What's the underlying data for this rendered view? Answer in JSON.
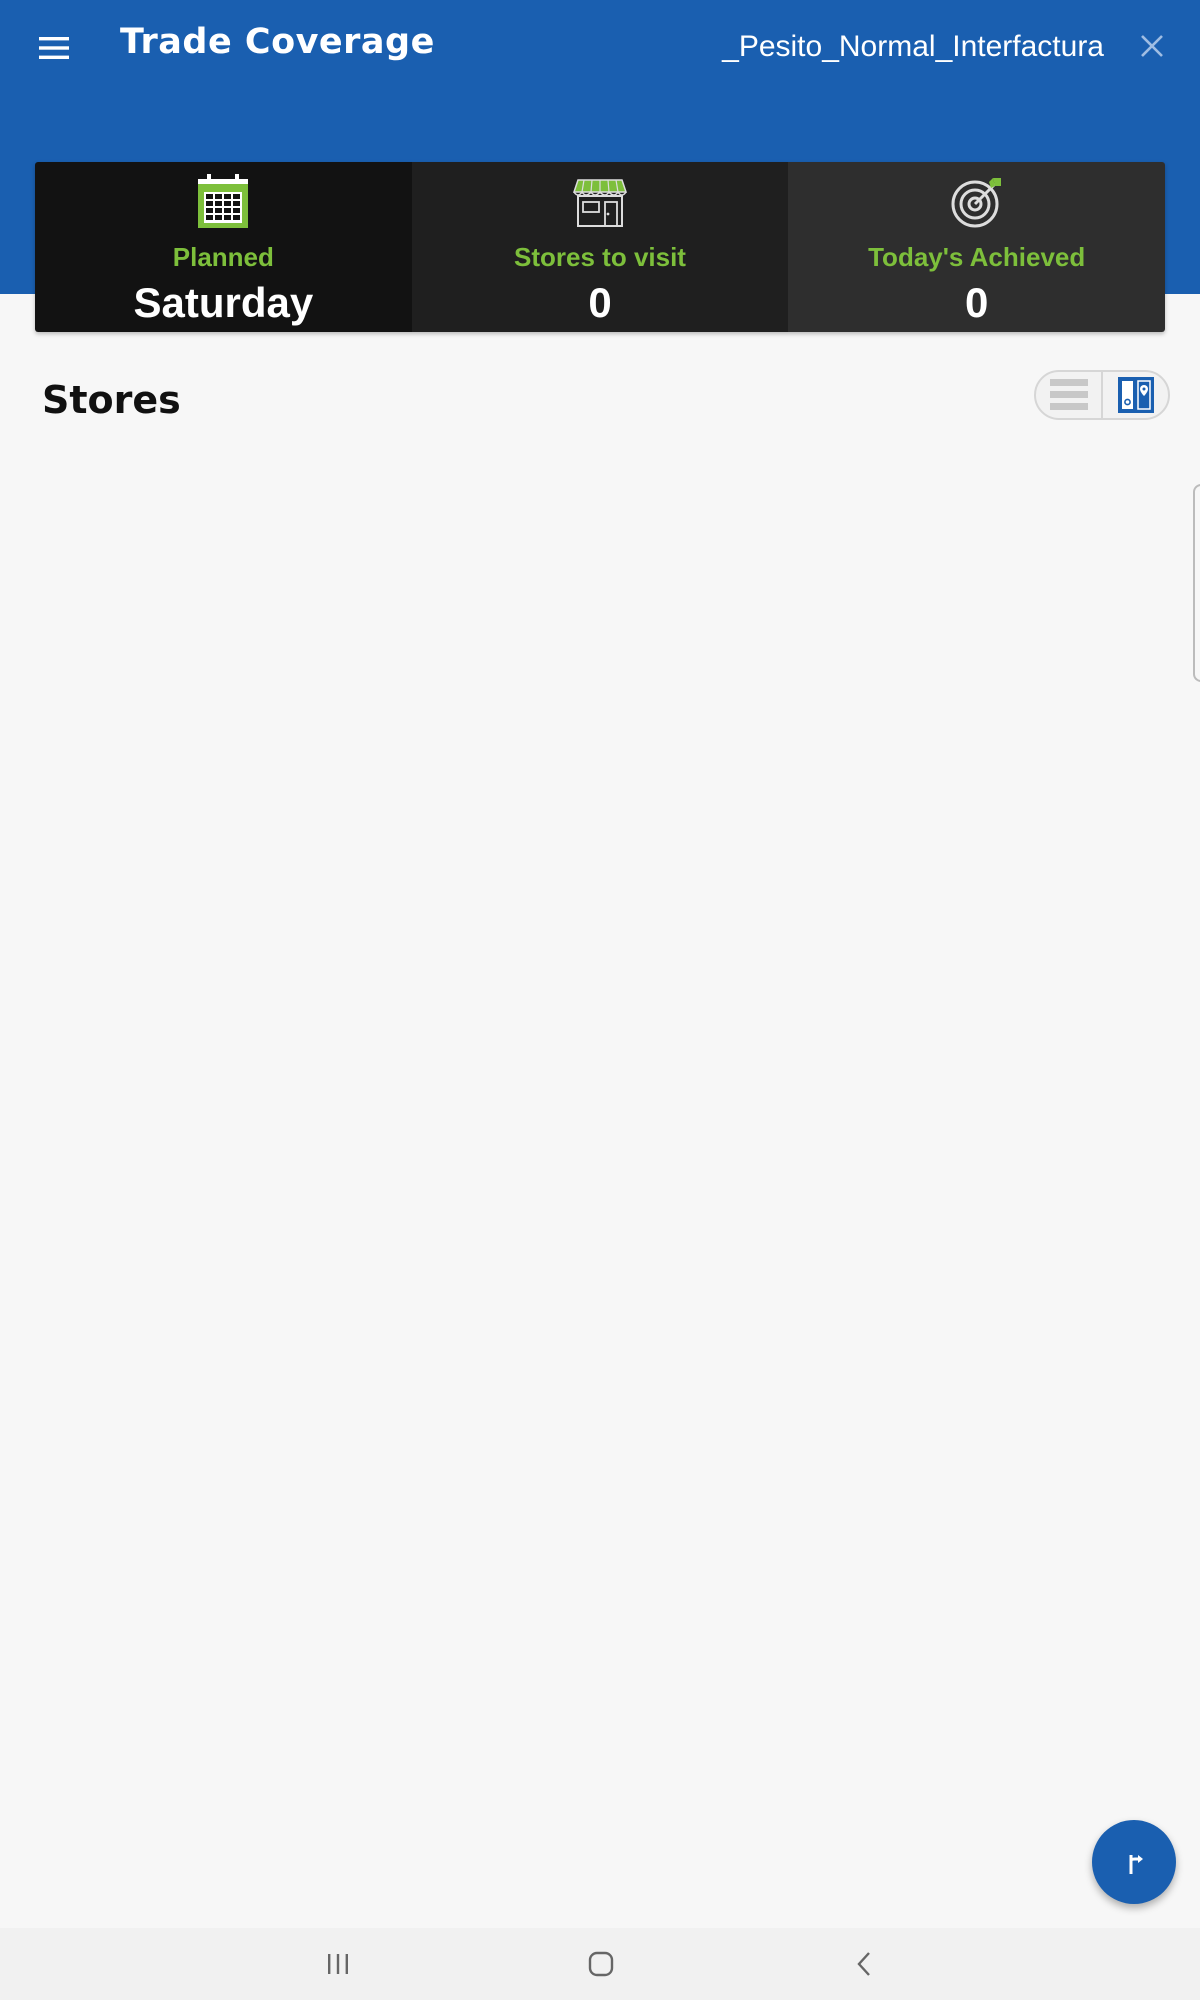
{
  "header": {
    "title": "Trade Coverage",
    "profile_name": "_Pesito_Normal_Interfactura",
    "icons": {
      "menu": "hamburger-menu-icon",
      "close": "close-icon"
    },
    "color": "#1a5fb0"
  },
  "summary": {
    "planned": {
      "label": "Planned",
      "value": "Saturday",
      "icon": "calendar-icon"
    },
    "stores_to_visit": {
      "label": "Stores to visit",
      "value": "0",
      "icon": "storefront-icon"
    },
    "achieved": {
      "label": "Today's Achieved",
      "value": "0",
      "icon": "target-icon"
    },
    "label_color": "#7dbf3b"
  },
  "stores": {
    "title": "Stores",
    "view_toggle": {
      "list_icon": "list-view-icon",
      "map_icon": "map-view-icon",
      "selected": "map"
    }
  },
  "fab": {
    "icon": "route-icon"
  },
  "navbar": {
    "icons": [
      "recent-apps-icon",
      "home-icon",
      "back-icon"
    ]
  }
}
